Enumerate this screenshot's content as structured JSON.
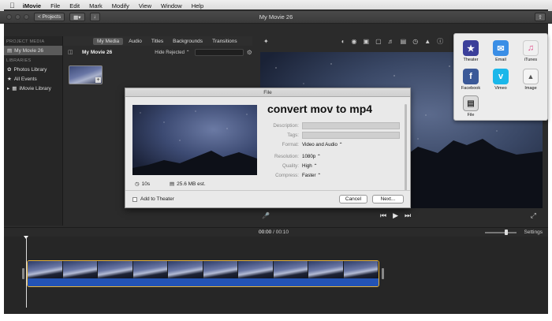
{
  "menubar": {
    "apple": "",
    "items": [
      "iMovie",
      "File",
      "Edit",
      "Mark",
      "Modify",
      "View",
      "Window",
      "Help"
    ]
  },
  "toolbar": {
    "projects_label": "< Projects",
    "window_title": "My Movie 26"
  },
  "sidebar": {
    "project_media_header": "PROJECT MEDIA",
    "project_item": "My Movie 26",
    "libraries_header": "LIBRARIES",
    "libraries": [
      "Photos Library",
      "All Events",
      "iMovie Library"
    ]
  },
  "browser": {
    "tabs": [
      "My Media",
      "Audio",
      "Titles",
      "Backgrounds",
      "Transitions"
    ],
    "active_tab": "My Media",
    "project_name": "My Movie 26",
    "filter": "Hide Rejected ⌃"
  },
  "share_popover": {
    "items": [
      {
        "label": "Theater",
        "icon": "theater-icon",
        "color": "#3b3f9a"
      },
      {
        "label": "Email",
        "icon": "email-icon",
        "color": "#3a8ee6"
      },
      {
        "label": "iTunes",
        "icon": "itunes-icon",
        "color": "#e04c8a"
      },
      {
        "label": "Facebook",
        "icon": "facebook-icon",
        "color": "#3b5998"
      },
      {
        "label": "Vimeo",
        "icon": "vimeo-icon",
        "color": "#1ab7ea"
      },
      {
        "label": "Image",
        "icon": "image-icon",
        "color": "#cfcfcf"
      },
      {
        "label": "File",
        "icon": "file-icon",
        "color": "#d9d9d9"
      }
    ]
  },
  "dialog": {
    "title": "File",
    "heading": "convert mov to mp4",
    "fields": {
      "description_label": "Description:",
      "tags_label": "Tags:",
      "format_label": "Format:",
      "format_value": "Video and Audio ⌃",
      "resolution_label": "Resolution:",
      "resolution_value": "1080p ⌃",
      "quality_label": "Quality:",
      "quality_value": "High ⌃",
      "compress_label": "Compress:",
      "compress_value": "Faster ⌃"
    },
    "duration": "10s",
    "size": "25.6 MB est.",
    "add_to_theater": "Add to Theater",
    "cancel": "Cancel",
    "next": "Next..."
  },
  "timeline": {
    "current_time": "00:00",
    "separator": " / ",
    "total_time": "00:10",
    "settings": "Settings"
  },
  "colors": {
    "clip_border": "#e6b33a",
    "audio": "#2453b4"
  }
}
